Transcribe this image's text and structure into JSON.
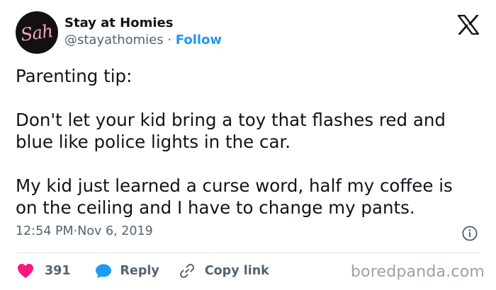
{
  "author": {
    "avatar_text": "Sah",
    "display_name": "Stay at Homies",
    "handle": "@stayathomies",
    "separator": " · ",
    "follow_label": "Follow"
  },
  "tweet": {
    "text": "Parenting tip:\n\nDon't let your kid bring a toy that flashes red and\nblue like police lights in the car.\n\nMy kid just learned a curse word, half my coffee is\non the ceiling and I have to change my pants.",
    "time": "12:54 PM",
    "date_separator": " · ",
    "date": "Nov 6, 2019"
  },
  "actions": {
    "like_count": "391",
    "reply_label": "Reply",
    "copy_link_label": "Copy link"
  },
  "watermark": "boredpanda.com",
  "icons": {
    "platform": "x-logo-icon",
    "info": "info-icon",
    "like": "heart-icon",
    "reply": "speech-bubble-icon",
    "copy_link": "link-icon"
  },
  "colors": {
    "like": "#f91880",
    "reply": "#1d9bf0",
    "follow": "#1d9bf0",
    "text": "#0f1419",
    "secondary": "#536471"
  }
}
